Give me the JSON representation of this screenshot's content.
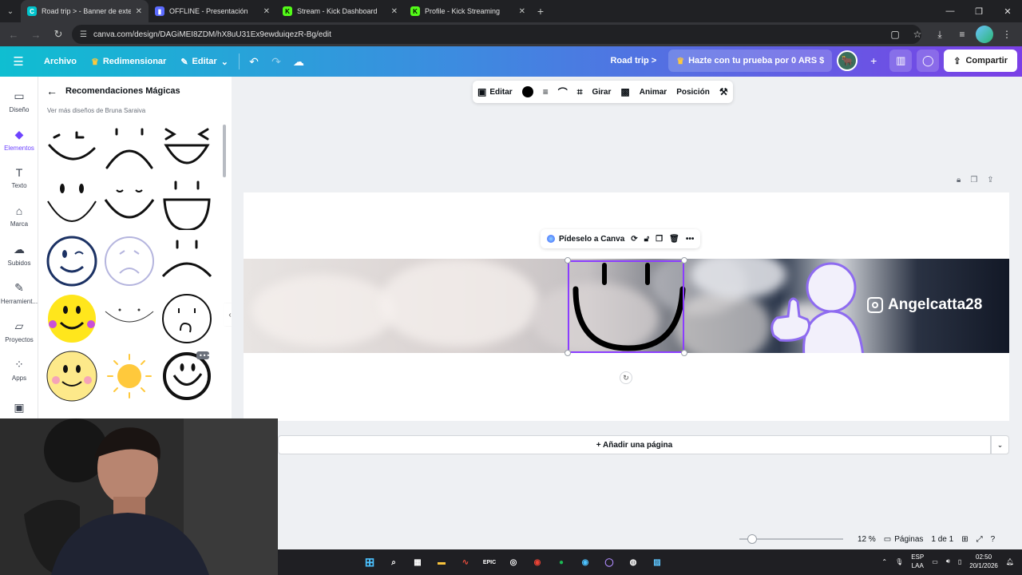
{
  "browser": {
    "tabs": [
      {
        "title": "Road trip > - Banner de exterio",
        "active": true,
        "favicon_color": "#00c4cc",
        "favicon_glyph": "C"
      },
      {
        "title": "OFFLINE - Presentación",
        "active": false,
        "favicon_color": "#5b6bff",
        "favicon_glyph": "▮"
      },
      {
        "title": "Stream - Kick Dashboard",
        "active": false,
        "favicon_color": "#53fc18",
        "favicon_glyph": "K"
      },
      {
        "title": "Profile - Kick Streaming",
        "active": false,
        "favicon_color": "#53fc18",
        "favicon_glyph": "K"
      }
    ],
    "url": "canva.com/design/DAGiMEI8ZDM/hX8uU31Ex9ewduiqezR-Bg/edit"
  },
  "canva_header": {
    "file": "Archivo",
    "resize": "Redimensionar",
    "edit": "Editar",
    "doc_title": "Road trip >",
    "trial": "Hazte con tu prueba por 0 ARS $",
    "share": "Compartir"
  },
  "rail": [
    {
      "label": "Diseño",
      "icon": "layout-icon"
    },
    {
      "label": "Elementos",
      "icon": "shapes-icon",
      "active": true
    },
    {
      "label": "Texto",
      "icon": "text-icon"
    },
    {
      "label": "Marca",
      "icon": "brand-icon"
    },
    {
      "label": "Subidos",
      "icon": "upload-icon"
    },
    {
      "label": "Herramient...",
      "icon": "tools-icon"
    },
    {
      "label": "Proyectos",
      "icon": "folder-icon"
    },
    {
      "label": "Apps",
      "icon": "apps-icon"
    }
  ],
  "panel": {
    "title": "Recomendaciones Mágicas",
    "subtitle": "Ver más diseños de Bruna Saraiva"
  },
  "context_toolbar": {
    "edit": "Editar",
    "rotate": "Girar",
    "animate": "Animar",
    "position": "Posición"
  },
  "element_toolbar": {
    "ask_canva": "Pídeselo a Canva"
  },
  "banner": {
    "handle": "Angelcatta28"
  },
  "add_page": "+ Añadir una página",
  "footer": {
    "zoom": "12 %",
    "pages_label": "Páginas",
    "page_count": "1 de 1",
    "zoom_fraction": 0.08
  },
  "taskbar": {
    "lang_top": "ESP",
    "lang_bottom": "LAA",
    "time": "02:50",
    "date": "20/1/2026"
  }
}
